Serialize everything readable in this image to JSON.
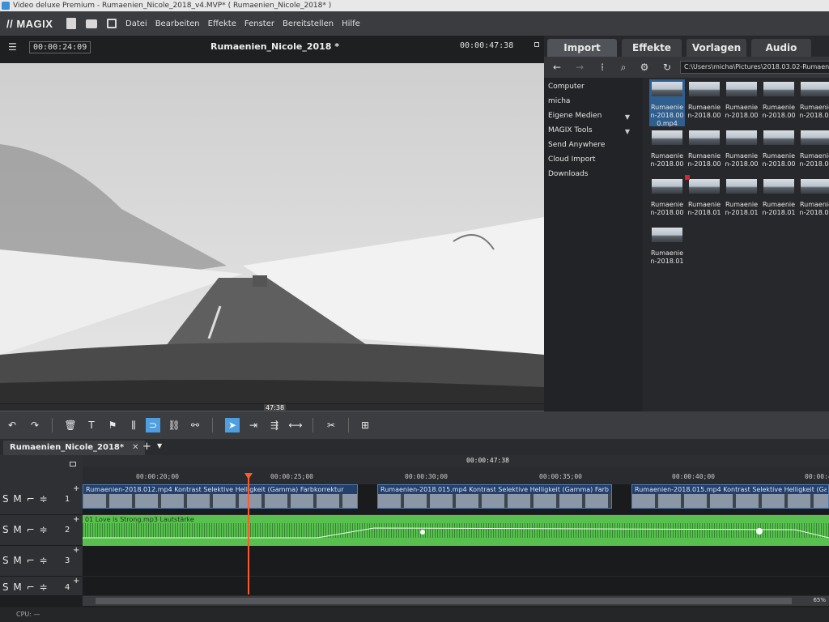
{
  "window": {
    "title": "Video deluxe Premium - Rumaenien_Nicole_2018_v4.MVP* ( Rumaenien_Nicole_2018* )"
  },
  "menubar": {
    "logo": "// MAGIX",
    "items": [
      "Datei",
      "Bearbeiten",
      "Effekte",
      "Fenster",
      "Bereitstellen",
      "Hilfe"
    ]
  },
  "monitor": {
    "timecode_current": "00:00:24:09",
    "title": "Rumaenien_Nicole_2018 *",
    "timecode_total": "00:00:47:38",
    "scrub_label": "47:38",
    "transport": {
      "in": "[",
      "out": "]",
      "prev_marker": "[◂",
      "prev": "|◂",
      "play": "▶",
      "next_marker": "[▸]",
      "next": "▸|"
    }
  },
  "pool": {
    "tabs": [
      "Import",
      "Effekte",
      "Vorlagen",
      "Audio"
    ],
    "active_tab": "Import",
    "path": "C:\\Users\\micha\\Pictures\\2018.03.02-Rumaenien_",
    "tree": [
      "Computer",
      "micha",
      "Eigene Medien",
      "MAGIX Tools",
      "Send Anywhere",
      "Cloud Import",
      "Downloads"
    ],
    "thumbs": [
      "Rumaenie\nn-2018.00\n0.mp4",
      "Rumaenie\nn-2018.00",
      "Rumaenie\nn-2018.00",
      "Rumaenie\nn-2018.00",
      "Rumaenie\nn-2018.00",
      "Rumaenie\nn-2018.00",
      "Rumaenie\nn-2018.00",
      "Rumaenie\nn-2018.00",
      "Rumaenie\nn-2018.00",
      "Rumaenie\nn-2018.00",
      "Rumaenie\nn-2018.00",
      "Rumaenie\nn-2018.01",
      "Rumaenie\nn-2018.01",
      "Rumaenie\nn-2018.01",
      "Rumaenie\nn-2018.01",
      "Rumaenie\nn-2018.01"
    ]
  },
  "project": {
    "tab_label": "Rumaenien_Nicole_2018*",
    "close": "✕",
    "add": "+",
    "menu": "▼"
  },
  "timeline": {
    "total": "00:00:47:38",
    "ruler": [
      "00:00:20;00",
      "00:00:25;00",
      "00:00:30;00",
      "00:00:35;00",
      "00:00:40;00",
      "00:00:4"
    ],
    "tracks": [
      {
        "ctrls": "S M ⌐ ≑",
        "num": "1"
      },
      {
        "ctrls": "S M ⌐ ≑",
        "num": "2"
      },
      {
        "ctrls": "S M ⌐ ≑",
        "num": "3"
      },
      {
        "ctrls": "S M ⌐ ≑",
        "num": "4"
      }
    ],
    "video_clips": [
      "Rumaenien-2018.012.mp4   Kontrast  Selektive Helligkeit (Gamma)  Farbkorrektur",
      "Rumaenien-2018.015.mp4   Kontrast  Selektive Helligkeit (Gamma)  Farb",
      "Rumaenien-2018.015.mp4   Kontrast  Selektive Helligkeit (Gamma)  Fa"
    ],
    "audio_clip": "01 Love is Strong.mp3   Lautstärke",
    "zoom": "65%"
  },
  "status": {
    "cpu": "CPU: —"
  }
}
